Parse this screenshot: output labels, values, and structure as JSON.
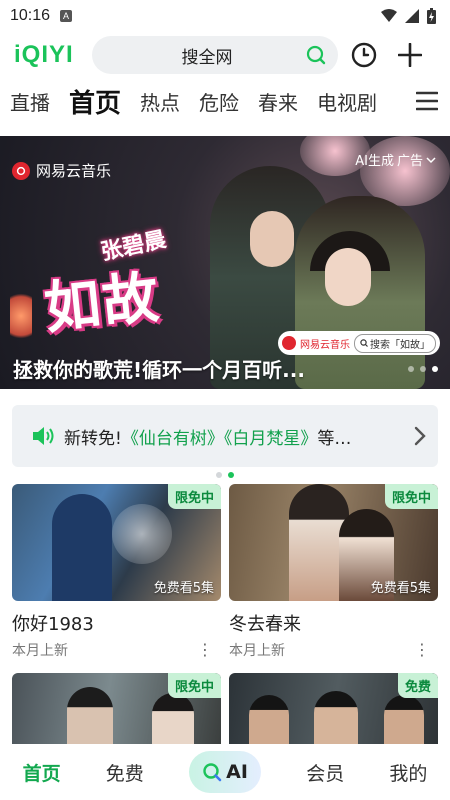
{
  "status_bar": {
    "time": "10:16",
    "notif": "A"
  },
  "header": {
    "logo": "iQIYI",
    "search_placeholder": "搜全网",
    "colors": {
      "brand": "#1bc35a"
    }
  },
  "tabs": [
    "直播",
    "首页",
    "热点",
    "危险",
    "春来",
    "电视剧"
  ],
  "active_tab": "首页",
  "banner": {
    "brand": "网易云音乐",
    "ai_label": "AI生成",
    "ad_label": "广告",
    "art_small": "张碧晨",
    "art_big": "如故",
    "chip_brand": "网易云音乐",
    "chip_search": "搜索「如故」",
    "caption": "拯救你的歌荒!循环一个月百听...",
    "dots": 3,
    "active_dot": 2
  },
  "notice": {
    "prefix": "新转免!",
    "title1": "《仙台有树》",
    "title2": "《白月梵星》",
    "suffix": "等…"
  },
  "cards": [
    {
      "badge": "限免中",
      "eps": "免费看5集",
      "title": "你好1983",
      "sub": "本月上新"
    },
    {
      "badge": "限免中",
      "eps": "免费看5集",
      "title": "冬去春来",
      "sub": "本月上新"
    },
    {
      "badge": "限免中"
    },
    {
      "badge": "免费"
    }
  ],
  "bottom_nav": {
    "home": "首页",
    "free": "免费",
    "ai": "AI",
    "vip": "会员",
    "mine": "我的"
  }
}
